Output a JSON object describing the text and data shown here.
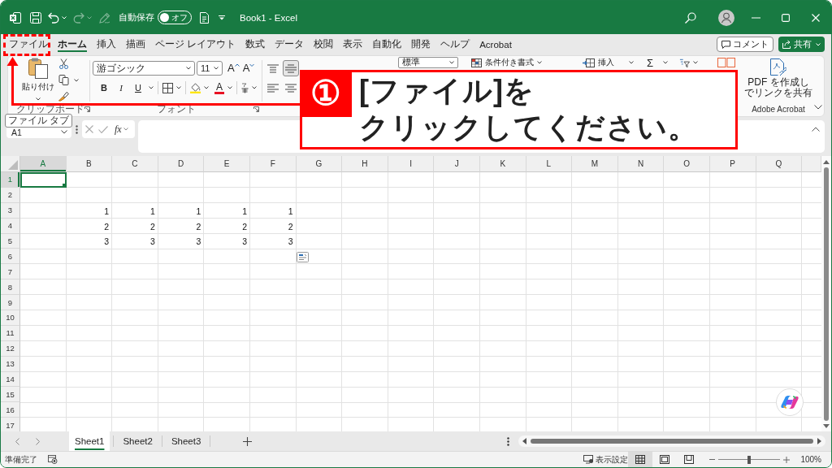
{
  "title_bar": {
    "redo": {
      "disabled": true
    },
    "pen": {
      "disabled": true
    },
    "autosave_label": "自動保存",
    "autosave": {
      "on": false,
      "label": "オフ"
    },
    "title": "Book1 - Excel"
  },
  "menu_tabs": [
    {
      "label": "ファイル",
      "selected": false
    },
    {
      "label": "ホーム",
      "selected": true
    },
    {
      "label": "挿入",
      "selected": false
    },
    {
      "label": "描画",
      "selected": false
    },
    {
      "label": "ページ レイアウト",
      "selected": false
    },
    {
      "label": "数式",
      "selected": false
    },
    {
      "label": "データ",
      "selected": false
    },
    {
      "label": "校閲",
      "selected": false
    },
    {
      "label": "表示",
      "selected": false
    },
    {
      "label": "自動化",
      "selected": false
    },
    {
      "label": "開発",
      "selected": false
    },
    {
      "label": "ヘルプ",
      "selected": false
    },
    {
      "label": "Acrobat",
      "selected": false
    }
  ],
  "comment_button": {
    "label": "コメント"
  },
  "share_button": {
    "label": "共有"
  },
  "ribbon": {
    "clipboard": {
      "paste_label": "貼り付け",
      "group_label": "クリップボード"
    },
    "font": {
      "font_name": "游ゴシック",
      "font_size": "11",
      "size_buttons": [
        {
          "kind": "grow",
          "label": "A"
        },
        {
          "kind": "shrink",
          "label": "A"
        }
      ],
      "style_buttons": [
        {
          "kind": "bold",
          "label": "B"
        },
        {
          "kind": "italic",
          "label": "I"
        },
        {
          "kind": "underline",
          "label": "U"
        }
      ],
      "font_color_label": "A",
      "group_label": "フォント"
    },
    "alignment": [
      {
        "kind": "top",
        "selected": false
      },
      {
        "kind": "middle",
        "selected": true
      },
      {
        "kind": "left",
        "selected": false
      },
      {
        "kind": "center",
        "selected": false
      }
    ],
    "number_format": "標準",
    "conditional_formatting": "条件付き書式",
    "insert_cells": "挿入",
    "autosum_label": "Σ",
    "acrobat": {
      "button_lines": [
        "PDF を作成し",
        "でリンクを共有"
      ],
      "group_label": "Adobe Acrobat"
    }
  },
  "tooltip": "ファイル タブ",
  "formula_bar": {
    "name_box": "A1",
    "function_label": "fx"
  },
  "grid": {
    "columns": [
      {
        "label": "A",
        "selected": true
      },
      {
        "label": "B",
        "selected": false
      },
      {
        "label": "C",
        "selected": false
      },
      {
        "label": "D",
        "selected": false
      },
      {
        "label": "E",
        "selected": false
      },
      {
        "label": "F",
        "selected": false
      },
      {
        "label": "G",
        "selected": false
      },
      {
        "label": "H",
        "selected": false
      },
      {
        "label": "I",
        "selected": false
      },
      {
        "label": "J",
        "selected": false
      },
      {
        "label": "K",
        "selected": false
      },
      {
        "label": "L",
        "selected": false
      },
      {
        "label": "M",
        "selected": false
      },
      {
        "label": "N",
        "selected": false
      },
      {
        "label": "O",
        "selected": false
      },
      {
        "label": "P",
        "selected": false
      },
      {
        "label": "Q",
        "selected": false
      }
    ],
    "rows": [
      {
        "label": "1",
        "selected": true
      },
      {
        "label": "2",
        "selected": false
      },
      {
        "label": "3",
        "selected": false,
        "cells": [
          "1",
          "1",
          "1",
          "1",
          "1"
        ]
      },
      {
        "label": "4",
        "selected": false,
        "cells": [
          "2",
          "2",
          "2",
          "2",
          "2"
        ]
      },
      {
        "label": "5",
        "selected": false,
        "cells": [
          "3",
          "3",
          "3",
          "3",
          "3"
        ]
      },
      {
        "label": "6",
        "selected": false
      },
      {
        "label": "7",
        "selected": false
      },
      {
        "label": "8",
        "selected": false
      },
      {
        "label": "9",
        "selected": false
      },
      {
        "label": "10",
        "selected": false
      },
      {
        "label": "11",
        "selected": false
      },
      {
        "label": "12",
        "selected": false
      },
      {
        "label": "13",
        "selected": false
      },
      {
        "label": "14",
        "selected": false
      },
      {
        "label": "15",
        "selected": false
      },
      {
        "label": "16",
        "selected": false
      },
      {
        "label": "17",
        "selected": false
      }
    ]
  },
  "sheet_tabs": [
    {
      "label": "Sheet1",
      "selected": true
    },
    {
      "label": "Sheet2",
      "selected": false
    },
    {
      "label": "Sheet3",
      "selected": false
    }
  ],
  "status_bar": {
    "status": "準備完了",
    "display_settings": "表示設定",
    "views": [
      {
        "kind": "normal",
        "selected": true
      },
      {
        "kind": "page_layout",
        "selected": false
      },
      {
        "kind": "page_break",
        "selected": false
      }
    ],
    "zoom": {
      "level": 0.5,
      "reading": "100%"
    }
  },
  "callout": {
    "number": "①",
    "lines": [
      "[ファイル]を",
      "クリックしてください。"
    ]
  }
}
